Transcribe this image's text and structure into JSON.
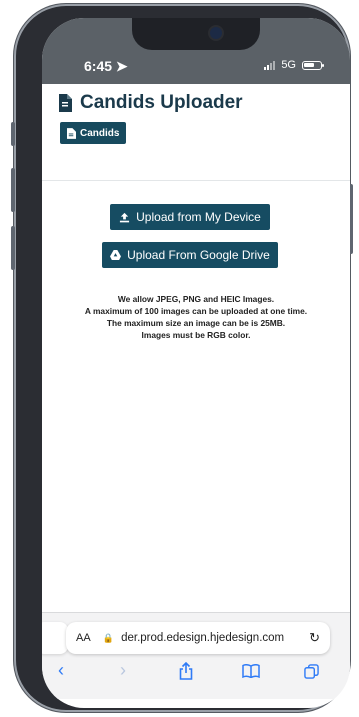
{
  "status_bar": {
    "time": "6:45",
    "network": "5G"
  },
  "app": {
    "title": "Candids Uploader",
    "tab_label": "Candids"
  },
  "buttons": {
    "upload_device": "Upload from My Device",
    "upload_drive": "Upload From Google Drive"
  },
  "info_lines": [
    "We allow JPEG, PNG and HEIC Images.",
    "A maximum of 100 images can be uploaded at one time.",
    "The maximum size an image can be is 25MB.",
    "Images must be RGB color."
  ],
  "browser": {
    "text_size": "AA",
    "url": " der.prod.edesign.hjedesign.com"
  },
  "colors": {
    "accent": "#164c62",
    "status_bar": "#5b6167",
    "safari_blue": "#2f7bf6"
  },
  "icons": {
    "title": "document-icon",
    "tab": "document-icon",
    "upload": "upload-icon",
    "drive": "google-drive-icon"
  }
}
